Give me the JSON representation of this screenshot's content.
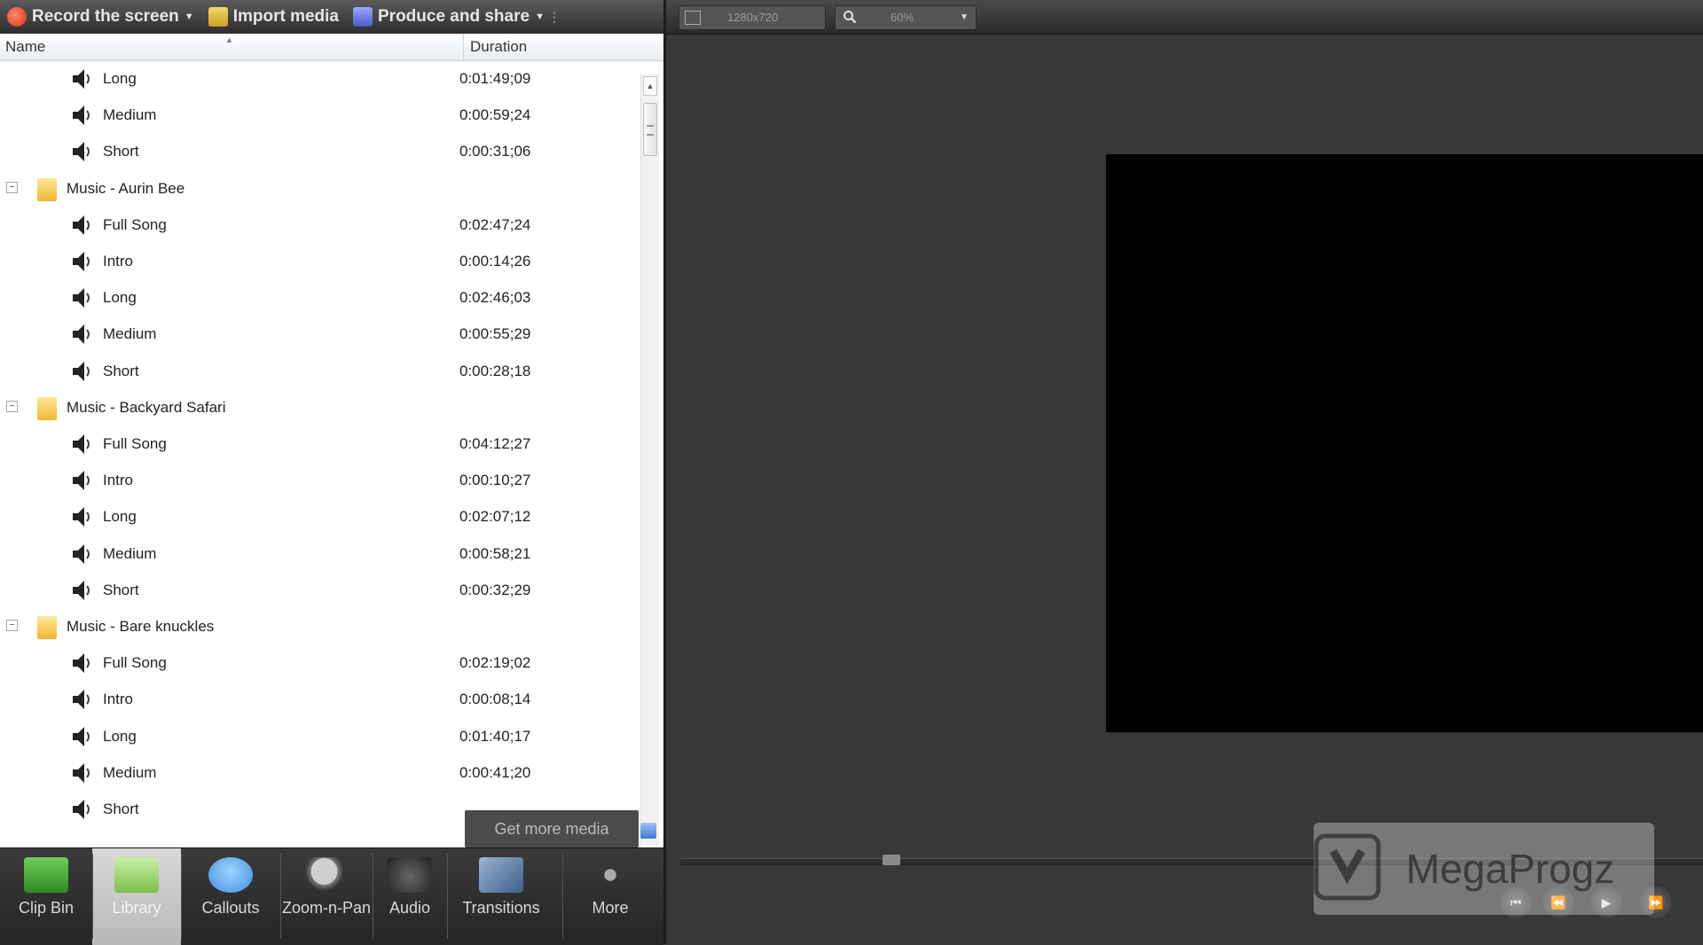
{
  "toolbar": {
    "record_label": "Record the screen",
    "import_label": "Import media",
    "produce_label": "Produce and share"
  },
  "columns": {
    "name": "Name",
    "duration": "Duration"
  },
  "rows": [
    {
      "type": "item",
      "label": "Long",
      "duration": "0:01:49;09"
    },
    {
      "type": "item",
      "label": "Medium",
      "duration": "0:00:59;24"
    },
    {
      "type": "item",
      "label": "Short",
      "duration": "0:00:31;06"
    },
    {
      "type": "folder",
      "label": "Music - Aurin Bee",
      "expander": "−"
    },
    {
      "type": "item",
      "label": "Full Song",
      "duration": "0:02:47;24"
    },
    {
      "type": "item",
      "label": "Intro",
      "duration": "0:00:14;26"
    },
    {
      "type": "item",
      "label": "Long",
      "duration": "0:02:46;03"
    },
    {
      "type": "item",
      "label": "Medium",
      "duration": "0:00:55;29"
    },
    {
      "type": "item",
      "label": "Short",
      "duration": "0:00:28;18"
    },
    {
      "type": "folder",
      "label": "Music - Backyard Safari",
      "expander": "−"
    },
    {
      "type": "item",
      "label": "Full Song",
      "duration": "0:04:12;27"
    },
    {
      "type": "item",
      "label": "Intro",
      "duration": "0:00:10;27"
    },
    {
      "type": "item",
      "label": "Long",
      "duration": "0:02:07;12"
    },
    {
      "type": "item",
      "label": "Medium",
      "duration": "0:00:58;21"
    },
    {
      "type": "item",
      "label": "Short",
      "duration": "0:00:32;29"
    },
    {
      "type": "folder",
      "label": "Music - Bare knuckles",
      "expander": "−"
    },
    {
      "type": "item",
      "label": "Full Song",
      "duration": "0:02:19;02"
    },
    {
      "type": "item",
      "label": "Intro",
      "duration": "0:00:08;14"
    },
    {
      "type": "item",
      "label": "Long",
      "duration": "0:01:40;17"
    },
    {
      "type": "item",
      "label": "Medium",
      "duration": "0:00:41;20"
    },
    {
      "type": "item",
      "label": "Short",
      "duration": ""
    }
  ],
  "get_more_media": "Get more media",
  "tabs": [
    {
      "label": "Clip Bin",
      "icon": "clip-bin-icon"
    },
    {
      "label": "Library",
      "icon": "library-icon",
      "active": true
    },
    {
      "label": "Callouts",
      "icon": "callouts-icon"
    },
    {
      "label": "Zoom-n-Pan",
      "icon": "zoom-n-pan-icon"
    },
    {
      "label": "Audio",
      "icon": "audio-icon"
    },
    {
      "label": "Transitions",
      "icon": "transitions-icon"
    },
    {
      "label": "More",
      "icon": "more-icon"
    }
  ],
  "preview": {
    "dimensions": "1280x720",
    "zoom": "60%"
  },
  "watermark": "MegaProgz"
}
